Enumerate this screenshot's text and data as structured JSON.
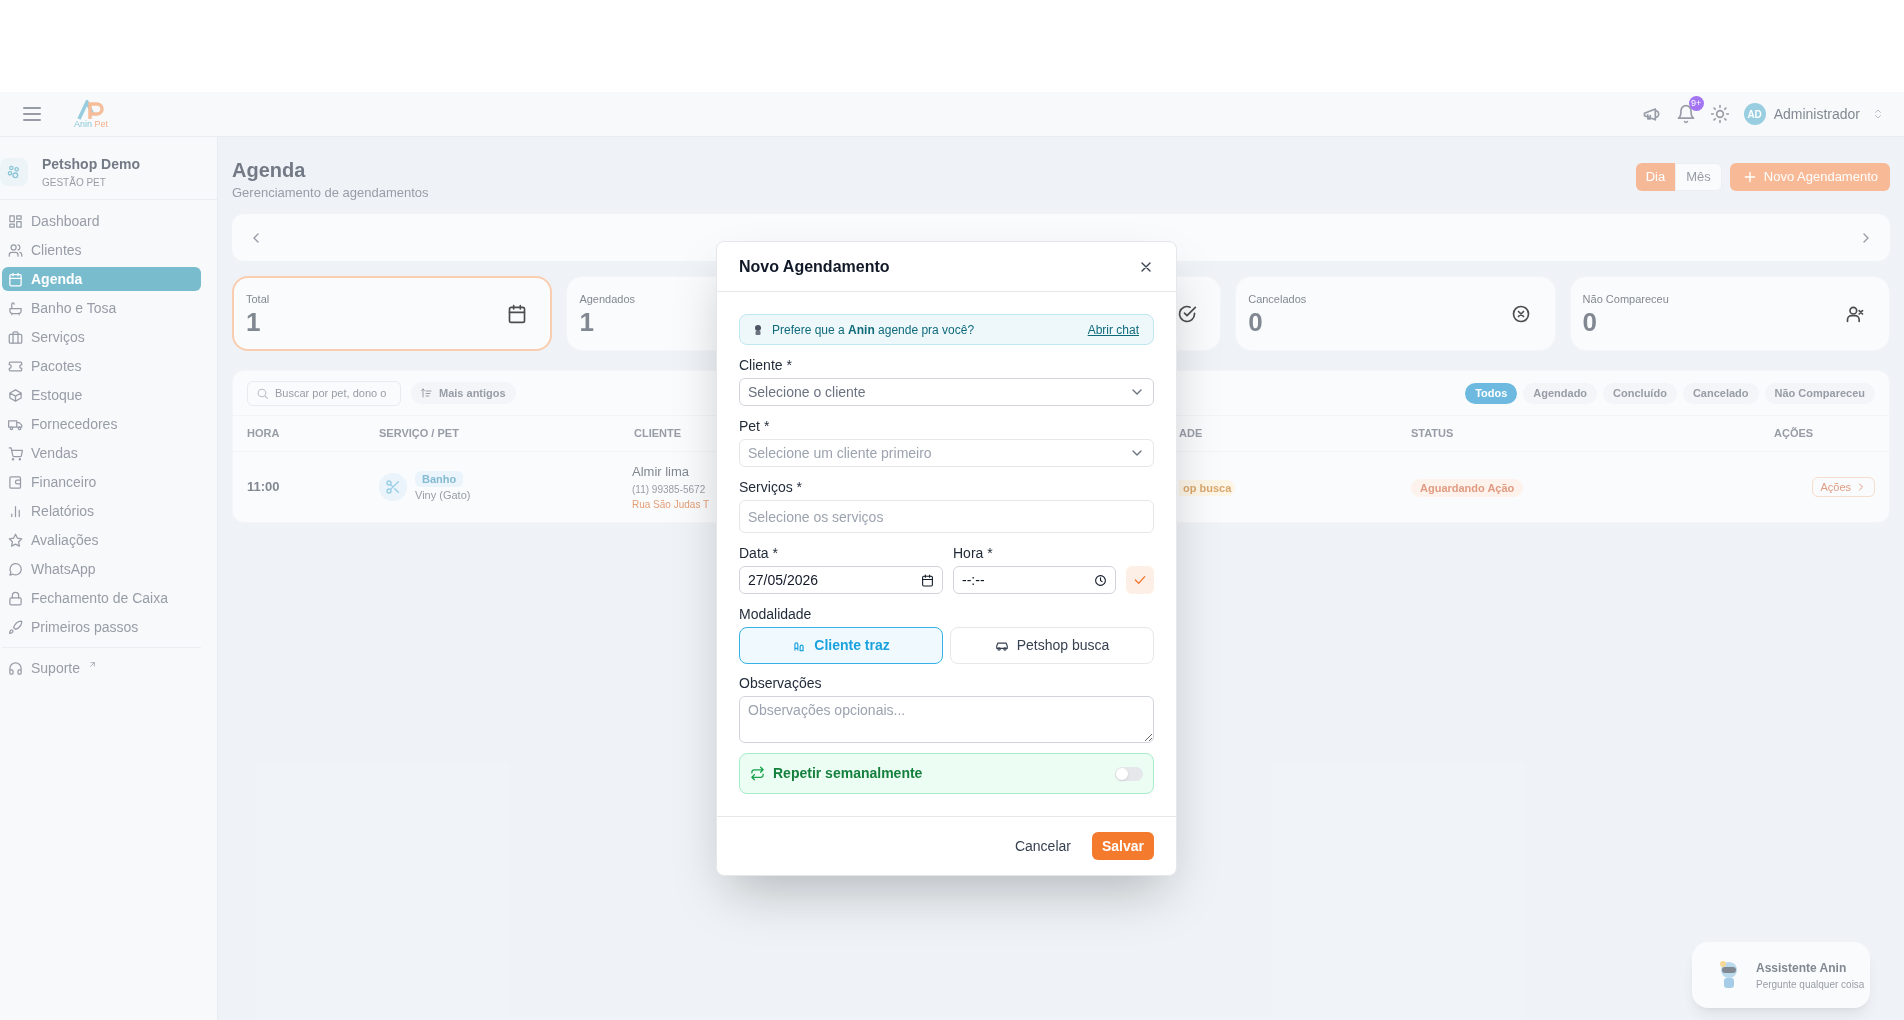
{
  "header": {
    "brand_first": "Anin",
    "brand_second": "Pet",
    "notification_badge": "9+",
    "user_initials": "AD",
    "user_name": "Administrador"
  },
  "sidebar": {
    "org_name": "Petshop Demo",
    "org_subtitle": "GESTÃO PET",
    "items": [
      {
        "label": "Dashboard",
        "selected": false
      },
      {
        "label": "Clientes",
        "selected": false
      },
      {
        "label": "Agenda",
        "selected": true
      },
      {
        "label": "Banho e Tosa",
        "selected": false
      },
      {
        "label": "Serviços",
        "selected": false
      },
      {
        "label": "Pacotes",
        "selected": false
      },
      {
        "label": "Estoque",
        "selected": false
      },
      {
        "label": "Fornecedores",
        "selected": false
      },
      {
        "label": "Vendas",
        "selected": false
      },
      {
        "label": "Financeiro",
        "selected": false
      },
      {
        "label": "Relatórios",
        "selected": false
      },
      {
        "label": "Avaliações",
        "selected": false
      },
      {
        "label": "WhatsApp",
        "selected": false
      },
      {
        "label": "Fechamento de Caixa",
        "selected": false
      },
      {
        "label": "Primeiros passos",
        "selected": false
      }
    ],
    "support": "Suporte"
  },
  "page": {
    "title": "Agenda",
    "subtitle": "Gerenciamento de agendamentos",
    "views": [
      {
        "label": "Dia",
        "selected": true
      },
      {
        "label": "Mês",
        "selected": false
      }
    ],
    "new_button": "Novo Agendamento"
  },
  "stats": [
    {
      "kind": "total",
      "label": "Total",
      "value": "1",
      "selected": true
    },
    {
      "kind": "scheduled",
      "label": "Agendados",
      "value": "1",
      "selected": false
    },
    {
      "kind": "done",
      "selected": false
    },
    {
      "kind": "cancelled",
      "label": "Cancelados",
      "value": "0",
      "selected": false
    },
    {
      "kind": "no_show",
      "label": "Não Compareceu",
      "value": "0",
      "selected": false
    }
  ],
  "table": {
    "search_placeholder": "Buscar por pet, dono o",
    "sort_button": "Mais antigos",
    "filters": [
      {
        "label": "Todos",
        "selected": true
      },
      {
        "label": "Agendado",
        "selected": false
      },
      {
        "label": "Concluído",
        "selected": false
      },
      {
        "label": "Cancelado",
        "selected": false
      },
      {
        "label": "Não Compareceu",
        "selected": false
      }
    ],
    "columns": [
      "HORA",
      "SERVIÇO / PET",
      "CLIENTE",
      "ADE",
      "STATUS",
      "AÇÕES"
    ],
    "rows": [
      {
        "time": "11:00",
        "service": "Banho",
        "pet": "Viny (Gato)",
        "client": "Almir lima",
        "phone": "(11) 99385-5672",
        "address": "Rua São Judas T",
        "modality": "op busca",
        "status": "Aguardando Ação",
        "actions": "Ações"
      }
    ]
  },
  "modal": {
    "title": "Novo Agendamento",
    "banner": "Prefere que a **Anin** agende pra você?",
    "banner_link": "Abrir chat",
    "client_label": "Cliente *",
    "client_placeholder": "Selecione o cliente",
    "pet_label": "Pet *",
    "pet_placeholder": "Selecione um cliente primeiro",
    "services_label": "Serviços *",
    "services_placeholder": "Selecione os serviços",
    "date_label": "Data *",
    "date_value": "27/05/2026",
    "time_label": "Hora *",
    "time_value": "--:--",
    "modality_label": "Modalidade",
    "modalities": [
      {
        "label": "Cliente traz",
        "selected": true
      },
      {
        "label": "Petshop busca",
        "selected": false
      }
    ],
    "notes_label": "Observações",
    "notes_placeholder": "Observações opcionais...",
    "repeat": {
      "label": "Repetir semanalmente",
      "on": false
    },
    "cancel": "Cancelar",
    "save": "Salvar"
  },
  "assistant": {
    "title": "Assistente Anin",
    "subtitle": "Pergunte qualquer coisa"
  }
}
